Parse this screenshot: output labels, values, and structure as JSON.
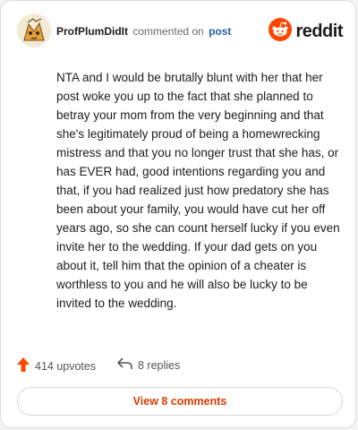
{
  "header": {
    "username": "ProfPlumDidIt",
    "verb": "commented on",
    "link": "post",
    "brand": "reddit"
  },
  "comment": {
    "text": "NTA and I would be brutally blunt with her that her post woke you up to the fact that she planned to betray your mom from the very beginning and that she's legitimately proud of being a homewrecking mistress and that you no longer trust that she has, or has EVER had, good intentions regarding you and that, if you had realized just how predatory she has been about your family, you would have cut her off years ago, so she can count herself lucky if you even invite her to the wedding. If your dad gets on you about it, tell him that the opinion of a cheater is worthless to you and he will also be lucky to be invited to the wedding."
  },
  "footer": {
    "upvotes": "414 upvotes",
    "replies": "8 replies",
    "view_comments": "View 8 comments"
  },
  "colors": {
    "accent": "#ff4500",
    "link": "#2a5db0",
    "button_text": "#d93a00"
  },
  "icons": [
    "avatar",
    "reddit-logo-icon",
    "upvote-arrow-icon",
    "reply-arrow-icon"
  ]
}
